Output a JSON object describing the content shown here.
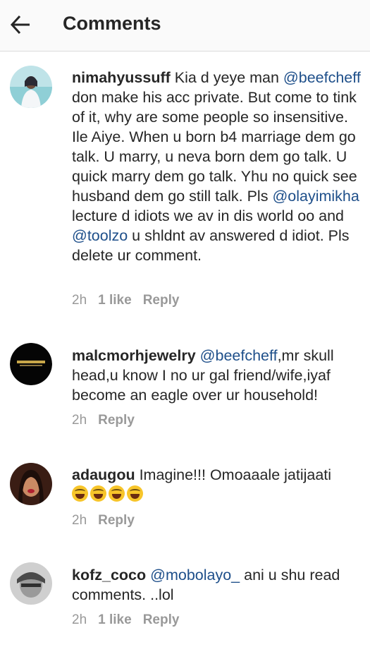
{
  "header": {
    "title": "Comments"
  },
  "comments": [
    {
      "username": "nimahyussuff",
      "text_1": " Kia d yeye man ",
      "mention_1": "@beefcheff",
      "text_2": " don make his acc private. But come to tink of it, why are some people so insensitive. Ile Aiye. When u born b4 marriage dem go talk. U marry, u neva born dem go talk. U quick marry dem go talk. Yhu no quick see husband dem go still talk. Pls ",
      "mention_2": "@olayimikha",
      "text_3": " lecture d idiots we av in dis world oo and ",
      "mention_3": "@toolzo",
      "text_4": " u shldnt av answered d idiot. Pls delete ur comment.",
      "time": "2h",
      "likes": "1 like",
      "reply": "Reply"
    },
    {
      "username": "malcmorhjewelry",
      "text_1": " ",
      "mention_1": "@beefcheff",
      "text_2": ",mr skull head,u know I no ur gal friend/wife,iyaf become an eagle over ur household!",
      "time": "2h",
      "reply": "Reply"
    },
    {
      "username": "adaugou",
      "text_1": " Imagine!!! Omoaaale jatijaati",
      "time": "2h",
      "reply": "Reply"
    },
    {
      "username": "kofz_coco",
      "text_1": " ",
      "mention_1": "@mobolayo_",
      "text_2": " ani u shu read comments. ..lol",
      "time": "2h",
      "likes": "1 like",
      "reply": "Reply"
    }
  ],
  "colors": {
    "mention": "#1e4f8a",
    "meta": "#999999",
    "header_bg": "#fafafa"
  },
  "icons": [
    "back-arrow-icon",
    "laughing-emoji-icon"
  ]
}
